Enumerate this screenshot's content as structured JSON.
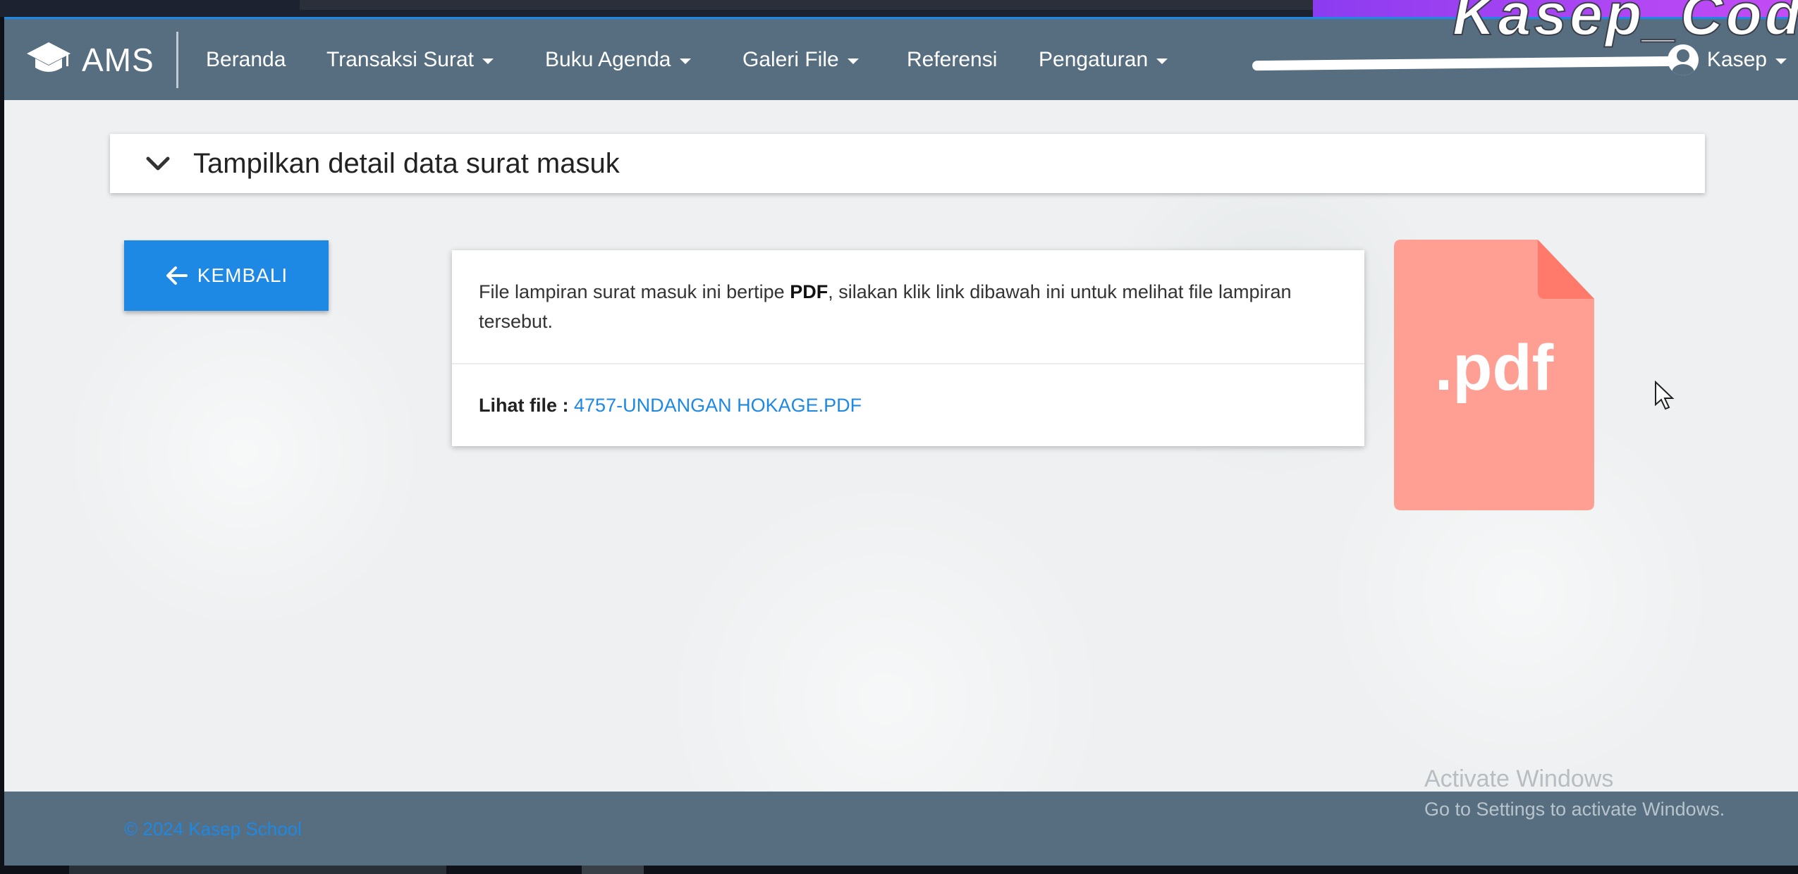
{
  "navbar": {
    "brand": "AMS",
    "items": [
      {
        "label": "Beranda",
        "has_dropdown": false
      },
      {
        "label": "Transaksi Surat",
        "has_dropdown": true
      },
      {
        "label": "Buku Agenda",
        "has_dropdown": true
      },
      {
        "label": "Galeri File",
        "has_dropdown": true
      },
      {
        "label": "Referensi",
        "has_dropdown": false
      },
      {
        "label": "Pengaturan",
        "has_dropdown": true
      }
    ],
    "user": "Kasep",
    "accent_color": "#1e88e5",
    "bar_color": "#566e80",
    "icons": {
      "brand": "graduation-cap-icon",
      "user": "account-circle-icon"
    }
  },
  "overlay": {
    "watermark": "Kasep_Code"
  },
  "detail": {
    "collapse_title": "Tampilkan detail data surat masuk",
    "collapse_icon": "chevron-down-icon"
  },
  "back_button": {
    "label": "KEMBALI",
    "icon": "arrow-left-icon"
  },
  "attachment": {
    "text_before": "File lampiran surat masuk ini bertipe ",
    "file_type": "PDF",
    "text_after": ", silakan klik link dibawah ini untuk melihat file lampiran tersebut.",
    "file_label": "Lihat file :",
    "file_name": "4757-UNDANGAN HOKAGE.PDF",
    "pdf_icon_label": ".pdf",
    "pdf_icon_color": "#ff9f94"
  },
  "windows_notice": {
    "title": "Activate Windows",
    "subtitle": "Go to Settings to activate Windows."
  },
  "footer": {
    "copyright": "© 2024 Kasep School"
  }
}
